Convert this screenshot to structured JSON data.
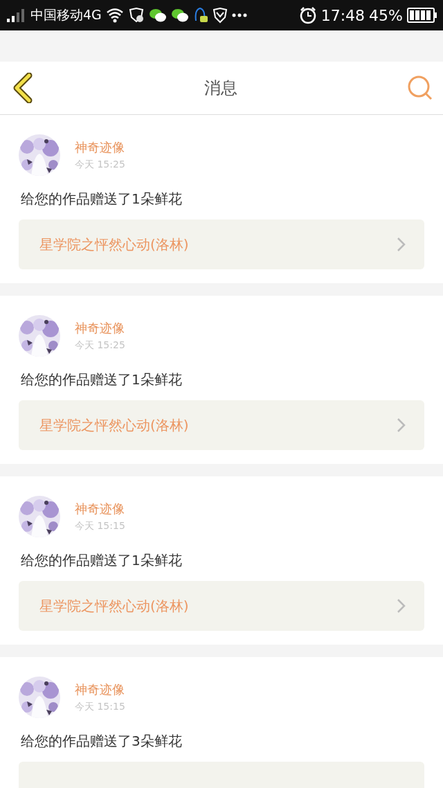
{
  "status_bar": {
    "carrier": "中国移动4G",
    "time": "17:48",
    "battery": "45%"
  },
  "header": {
    "title": "消息"
  },
  "messages": [
    {
      "name": "神奇迹像",
      "time": "今天 15:25",
      "text": "给您的作品赠送了1朵鲜花",
      "link": "星学院之怦然心动(洛林)"
    },
    {
      "name": "神奇迹像",
      "time": "今天 15:25",
      "text": "给您的作品赠送了1朵鲜花",
      "link": "星学院之怦然心动(洛林)"
    },
    {
      "name": "神奇迹像",
      "time": "今天 15:15",
      "text": "给您的作品赠送了1朵鲜花",
      "link": "星学院之怦然心动(洛林)"
    },
    {
      "name": "神奇迹像",
      "time": "今天 15:15",
      "text": "给您的作品赠送了3朵鲜花"
    }
  ]
}
